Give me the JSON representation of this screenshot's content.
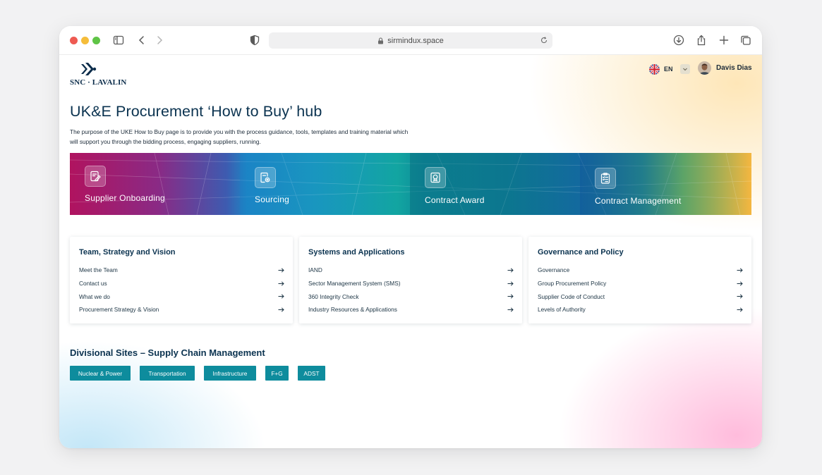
{
  "browser": {
    "url": "sirmindux.space"
  },
  "header": {
    "logo_text": "SNC · LAVALIN",
    "language": "EN",
    "user_name": "Davis Dias"
  },
  "hero": {
    "title": "UK&E Procurement ‘How to Buy’ hub",
    "intro": "The purpose of the UKE How to Buy page is to provide you with the process guidance, tools, templates and training material which will support you through the bidding process, engaging suppliers, running."
  },
  "banner": {
    "tiles": [
      {
        "label": "Supplier Onboarding",
        "icon": "edit-document-icon"
      },
      {
        "label": "Sourcing",
        "icon": "search-document-icon"
      },
      {
        "label": "Contract Award",
        "icon": "award-document-icon"
      },
      {
        "label": "Contract Management",
        "icon": "checklist-icon"
      }
    ]
  },
  "cards": [
    {
      "title": "Team, Strategy and Vision",
      "links": [
        "Meet the Team",
        "Contact us",
        "What we do",
        "Procurement Strategy & Vision"
      ]
    },
    {
      "title": "Systems and Applications",
      "links": [
        "IAND",
        "Sector Management System (SMS)",
        "360 Integrity Check",
        "Industry Resources & Applications"
      ]
    },
    {
      "title": "Governance and Policy",
      "links": [
        "Governance",
        "Group Procurement Policy",
        "Supplier Code of Conduct",
        "Levels of Authority"
      ]
    }
  ],
  "divisional": {
    "title": "Divisional Sites – Supply Chain Management",
    "sites": [
      "Nuclear & Power",
      "Transportation",
      "Infrastructure",
      "F+G",
      "ADST"
    ]
  },
  "colors": {
    "accent_teal": "#0e8c9d",
    "title_navy": "#0b3350"
  }
}
